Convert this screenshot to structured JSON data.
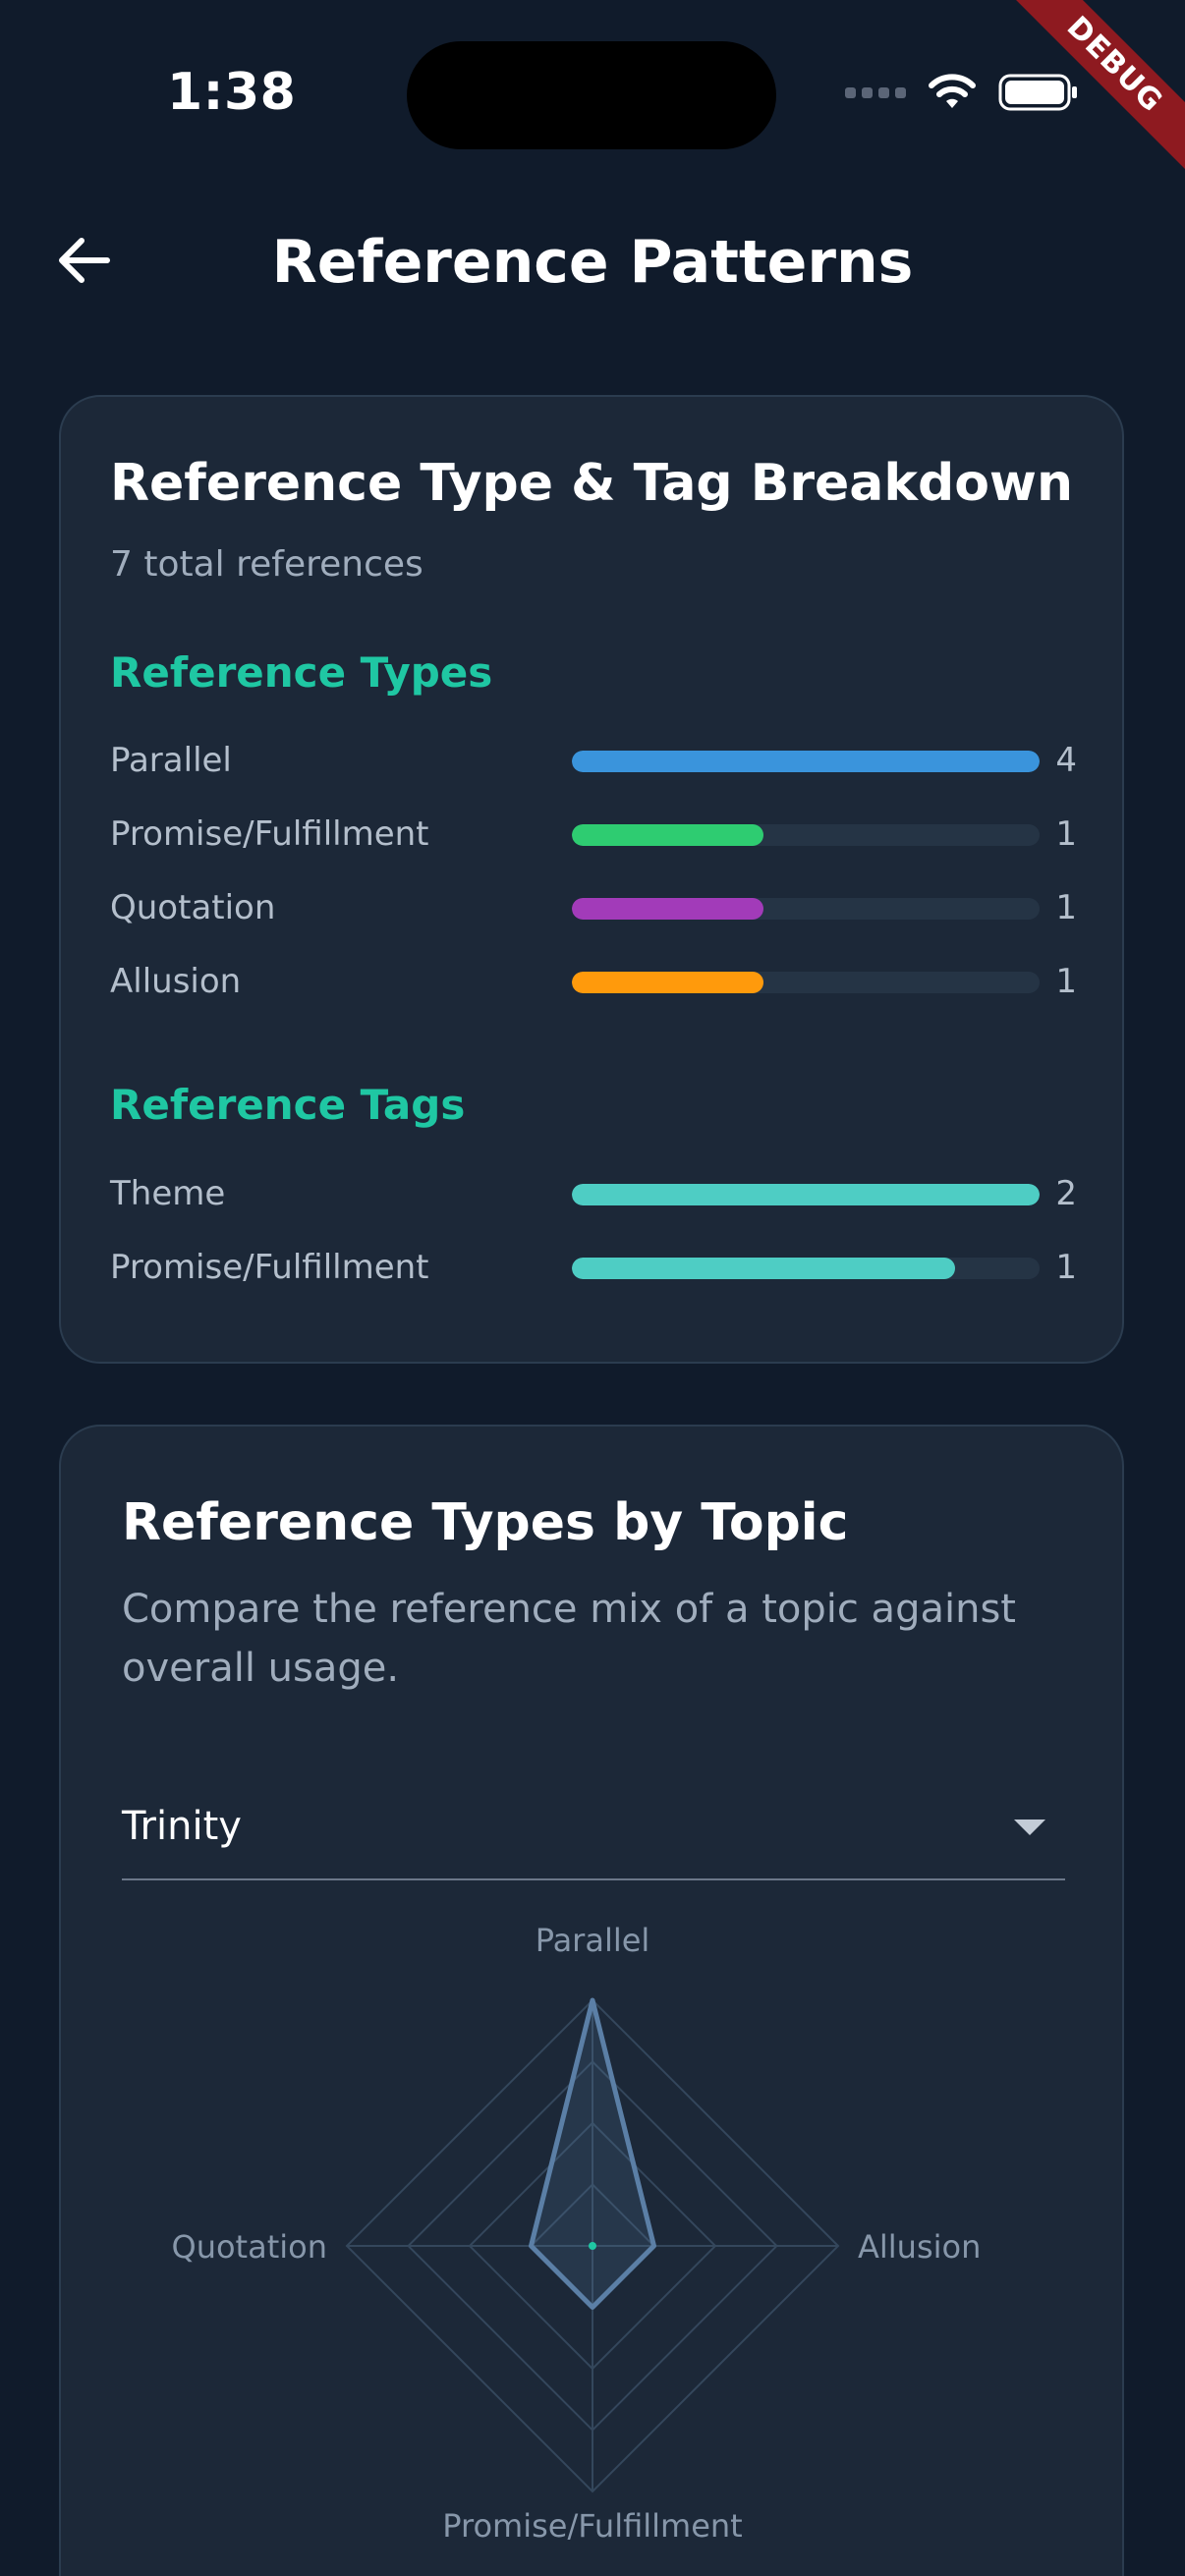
{
  "status": {
    "time": "1:38"
  },
  "debug_label": "DEBUG",
  "header": {
    "title": "Reference Patterns"
  },
  "breakdown": {
    "title": "Reference Type & Tag Breakdown",
    "subtitle": "7 total references",
    "types_heading": "Reference Types",
    "types": [
      {
        "label": "Parallel",
        "count": "4",
        "fill": 1.0,
        "color": "#3a94dc"
      },
      {
        "label": "Promise/Fulfillment",
        "count": "1",
        "fill": 0.41,
        "color": "#2ecc71"
      },
      {
        "label": "Quotation",
        "count": "1",
        "fill": 0.41,
        "color": "#a23bb9"
      },
      {
        "label": "Allusion",
        "count": "1",
        "fill": 0.41,
        "color": "#ff9a0c"
      }
    ],
    "tags_heading": "Reference Tags",
    "tags": [
      {
        "label": "Theme",
        "count": "2",
        "fill": 1.0,
        "color": "#4ecdc4"
      },
      {
        "label": "Promise/Fulfillment",
        "count": "1",
        "fill": 0.82,
        "color": "#4ecdc4"
      }
    ]
  },
  "by_topic": {
    "title": "Reference Types by Topic",
    "description": "Compare the reference mix of a topic against overall usage.",
    "selected_topic": "Trinity"
  },
  "chart_data": {
    "type": "radar",
    "axes": [
      "Parallel",
      "Allusion",
      "Promise/Fulfillment",
      "Quotation"
    ],
    "series": [
      {
        "values": [
          1.0,
          0.25,
          0.25,
          0.25
        ],
        "color": "#5b7fa6"
      }
    ],
    "rings": 4,
    "range": [
      0,
      1
    ]
  }
}
